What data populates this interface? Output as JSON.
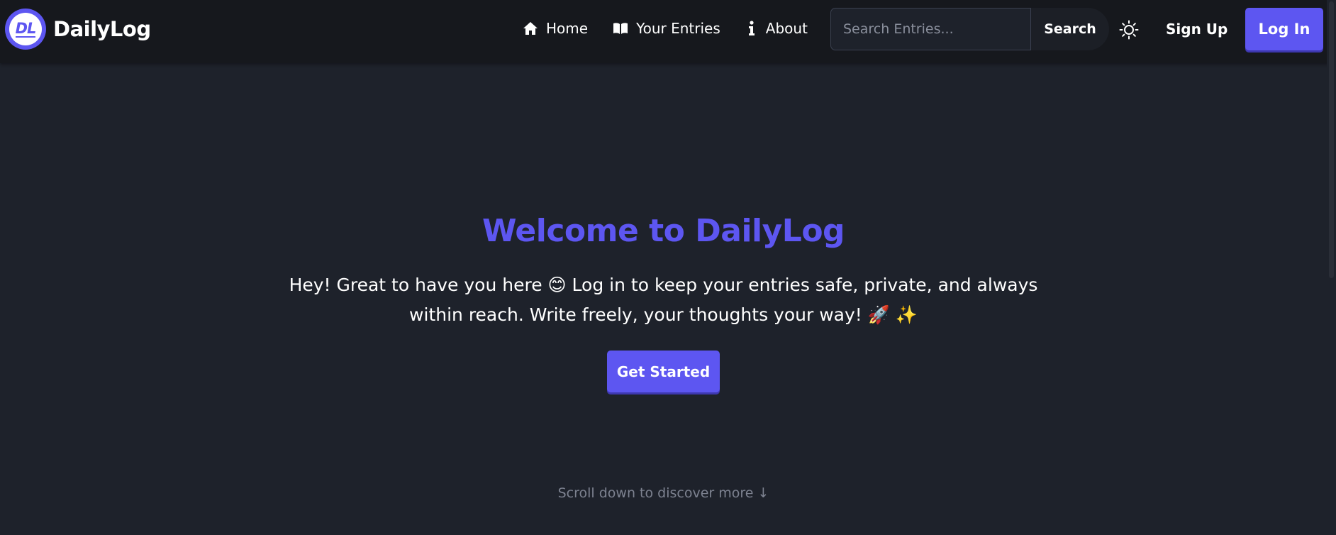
{
  "brand": {
    "logo_text": "DL",
    "name": "DailyLog",
    "logo_color": "#5d56f1"
  },
  "nav": {
    "links": [
      {
        "label": "Home",
        "icon": "home-icon"
      },
      {
        "label": "Your Entries",
        "icon": "book-icon"
      },
      {
        "label": "About",
        "icon": "info-icon"
      }
    ]
  },
  "search": {
    "placeholder": "Search Entries...",
    "value": "",
    "button_label": "Search"
  },
  "theme_toggle": {
    "icon": "sun-icon"
  },
  "auth": {
    "signup_label": "Sign Up",
    "login_label": "Log In"
  },
  "hero": {
    "title": "Welcome to DailyLog",
    "text": "Hey! Great to have you here 😊 Log in to keep your entries safe, private, and always within reach. Write freely, your thoughts your way! 🚀 ✨",
    "cta_label": "Get Started"
  },
  "scroll_hint": "Scroll down to discover more ↓",
  "colors": {
    "accent": "#5d56f1",
    "background": "#1e222b",
    "navbar": "#16181d",
    "muted_text": "#7d8290"
  }
}
